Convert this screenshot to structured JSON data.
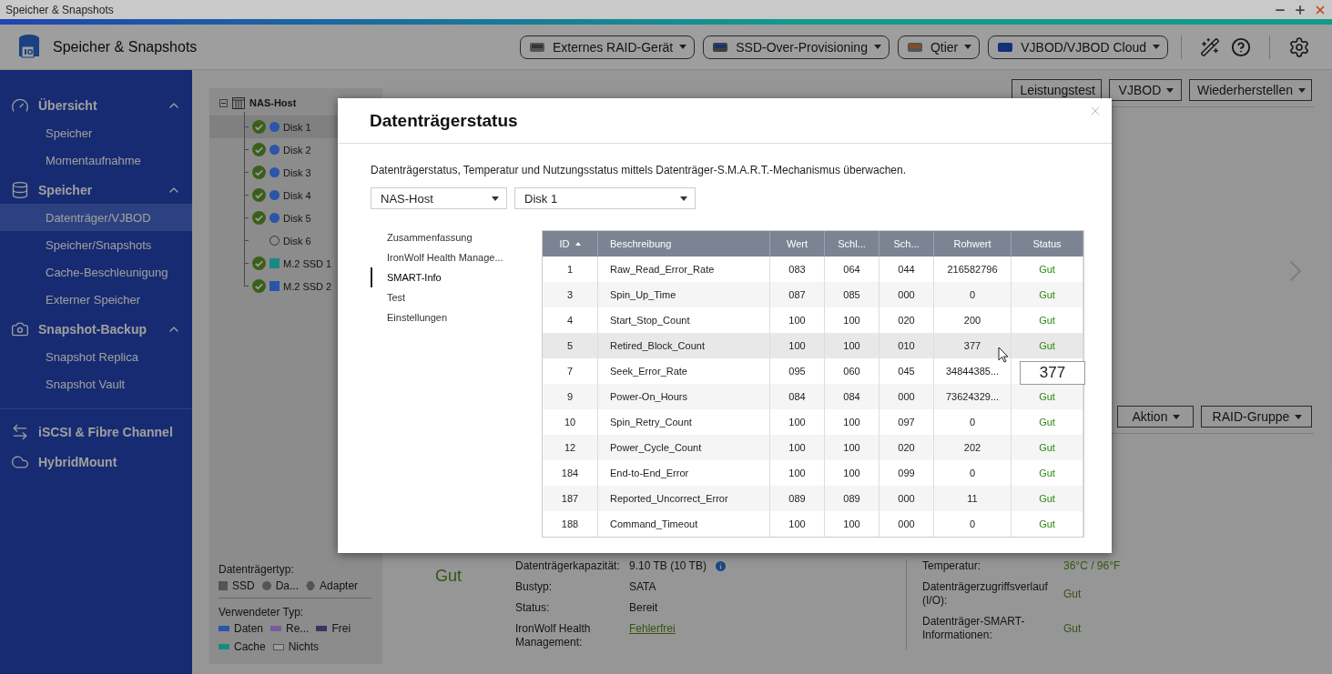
{
  "window": {
    "title": "Speicher & Snapshots"
  },
  "app": {
    "title": "Speicher & Snapshots"
  },
  "header_buttons": [
    {
      "label": "Externes RAID-Gerät"
    },
    {
      "label": "SSD-Over-Provisioning"
    },
    {
      "label": "Qtier"
    },
    {
      "label": "VJBOD/VJBOD Cloud"
    }
  ],
  "sidebar": {
    "sections": [
      {
        "label": "Übersicht",
        "expanded": true,
        "items": [
          {
            "label": "Speicher",
            "selected": false
          },
          {
            "label": "Momentaufnahme",
            "selected": false
          }
        ]
      },
      {
        "label": "Speicher",
        "expanded": true,
        "items": [
          {
            "label": "Datenträger/VJBOD",
            "selected": true
          },
          {
            "label": "Speicher/Snapshots",
            "selected": false
          },
          {
            "label": "Cache-Beschleunigung",
            "selected": false
          },
          {
            "label": "Externer Speicher",
            "selected": false
          }
        ]
      },
      {
        "label": "Snapshot-Backup",
        "expanded": true,
        "items": [
          {
            "label": "Snapshot Replica",
            "selected": false
          },
          {
            "label": "Snapshot Vault",
            "selected": false
          }
        ]
      },
      {
        "label": "iSCSI & Fibre Channel",
        "expanded": false
      },
      {
        "label": "HybridMount",
        "expanded": false
      }
    ]
  },
  "tree": {
    "root": "NAS-Host",
    "expanded": true,
    "children": [
      {
        "label": "Disk 1",
        "selected": true,
        "ok": true,
        "kind": "circle",
        "color": "#2a55a8"
      },
      {
        "label": "Disk 2",
        "selected": false,
        "ok": true,
        "kind": "circle",
        "color": "#2a55a8"
      },
      {
        "label": "Disk 3",
        "selected": false,
        "ok": true,
        "kind": "circle",
        "color": "#2a55a8"
      },
      {
        "label": "Disk 4",
        "selected": false,
        "ok": true,
        "kind": "circle",
        "color": "#2a55a8"
      },
      {
        "label": "Disk 5",
        "selected": false,
        "ok": true,
        "kind": "circle",
        "color": "#2a55a8"
      },
      {
        "label": "Disk 6",
        "selected": false,
        "ok": false,
        "kind": "empty"
      },
      {
        "label": "M.2 SSD 1",
        "selected": false,
        "ok": true,
        "kind": "square",
        "color": "#178a85"
      },
      {
        "label": "M.2 SSD 2",
        "selected": false,
        "ok": true,
        "kind": "square",
        "color": "#2a55a8"
      }
    ]
  },
  "legend": {
    "disk_type_title": "Datenträgertyp:",
    "disk_types": [
      {
        "label": "SSD",
        "kind": "square"
      },
      {
        "label": "Da...",
        "kind": "circle"
      },
      {
        "label": "Adapter",
        "kind": "hexagon"
      }
    ],
    "usage_title": "Verwendeter Typ:",
    "usage_types": [
      {
        "label": "Daten",
        "kind": "solid",
        "color": "#2a55a8"
      },
      {
        "label": "Re...",
        "kind": "hatched",
        "color": "#7a5a9a"
      },
      {
        "label": "Frei",
        "kind": "solid",
        "color": "#3a3560"
      },
      {
        "label": "Cache",
        "kind": "solid",
        "color": "#178a85"
      },
      {
        "label": "Nichts",
        "kind": "outline"
      }
    ]
  },
  "toolbar": [
    {
      "label": "Leistungstest",
      "dropdown": false
    },
    {
      "label": "VJBOD",
      "dropdown": true
    },
    {
      "label": "Wiederherstellen",
      "dropdown": true
    }
  ],
  "action_bar": [
    {
      "label": "Aktion",
      "dropdown": true
    },
    {
      "label": "RAID-Gruppe",
      "dropdown": true
    }
  ],
  "details": {
    "health": "Gut",
    "left": [
      {
        "label": "Datenträgerkapazität:",
        "value": "9.10 TB (10 TB)",
        "kind": "info"
      },
      {
        "label": "Bustyp:",
        "value": "SATA",
        "kind": "text"
      },
      {
        "label": "Status:",
        "value": "Bereit",
        "kind": "text"
      },
      {
        "label": "IronWolf Health Management:",
        "value": "Fehlerfrei",
        "kind": "link"
      }
    ],
    "right": [
      {
        "label": "Temperatur:",
        "value": "36°C / 96°F"
      },
      {
        "label": "Datenträgerzugriffsverlauf (I/O):",
        "value": "Gut"
      },
      {
        "label": "Datenträger-SMART-Informationen:",
        "value": "Gut"
      }
    ]
  },
  "dialog": {
    "title": "Datenträgerstatus",
    "description": "Datenträgerstatus, Temperatur und Nutzungsstatus mittels Datenträger-S.M.A.R.T.-Mechanismus überwachen.",
    "selects": [
      {
        "value": "NAS-Host"
      },
      {
        "value": "Disk 1"
      }
    ],
    "nav": [
      {
        "label": "Zusammenfassung",
        "selected": false
      },
      {
        "label": "IronWolf Health Manage...",
        "selected": false
      },
      {
        "label": "SMART-Info",
        "selected": true
      },
      {
        "label": "Test",
        "selected": false
      },
      {
        "label": "Einstellungen",
        "selected": false
      }
    ],
    "table": {
      "columns": [
        {
          "label": "ID",
          "sorted": true
        },
        {
          "label": "Beschreibung",
          "sorted": false
        },
        {
          "label": "Wert",
          "sorted": false
        },
        {
          "label": "Schl...",
          "sorted": false
        },
        {
          "label": "Sch...",
          "sorted": false
        },
        {
          "label": "Rohwert",
          "sorted": false
        },
        {
          "label": "Status",
          "sorted": false
        }
      ],
      "rows": [
        {
          "cells": [
            "1",
            "Raw_Read_Error_Rate",
            "083",
            "064",
            "044",
            "216582796"
          ],
          "status": "Gut",
          "hovered": false
        },
        {
          "cells": [
            "3",
            "Spin_Up_Time",
            "087",
            "085",
            "000",
            "0"
          ],
          "status": "Gut",
          "hovered": false
        },
        {
          "cells": [
            "4",
            "Start_Stop_Count",
            "100",
            "100",
            "020",
            "200"
          ],
          "status": "Gut",
          "hovered": false
        },
        {
          "cells": [
            "5",
            "Retired_Block_Count",
            "100",
            "100",
            "010",
            "377"
          ],
          "status": "Gut",
          "hovered": true
        },
        {
          "cells": [
            "7",
            "Seek_Error_Rate",
            "095",
            "060",
            "045",
            "34844385..."
          ],
          "hovered": false
        },
        {
          "cells": [
            "9",
            "Power-On_Hours",
            "084",
            "084",
            "000",
            "73624329..."
          ],
          "status": "Gut",
          "hovered": false
        },
        {
          "cells": [
            "10",
            "Spin_Retry_Count",
            "100",
            "100",
            "097",
            "0"
          ],
          "status": "Gut",
          "hovered": false
        },
        {
          "cells": [
            "12",
            "Power_Cycle_Count",
            "100",
            "100",
            "020",
            "202"
          ],
          "status": "Gut",
          "hovered": false
        },
        {
          "cells": [
            "184",
            "End-to-End_Error",
            "100",
            "100",
            "099",
            "0"
          ],
          "status": "Gut",
          "hovered": false
        },
        {
          "cells": [
            "187",
            "Reported_Uncorrect_Error",
            "089",
            "089",
            "000",
            "11"
          ],
          "status": "Gut",
          "hovered": false
        },
        {
          "cells": [
            "188",
            "Command_Timeout",
            "100",
            "100",
            "000",
            "0"
          ],
          "status": "Gut",
          "hovered": false
        }
      ]
    },
    "tooltip": "377"
  }
}
